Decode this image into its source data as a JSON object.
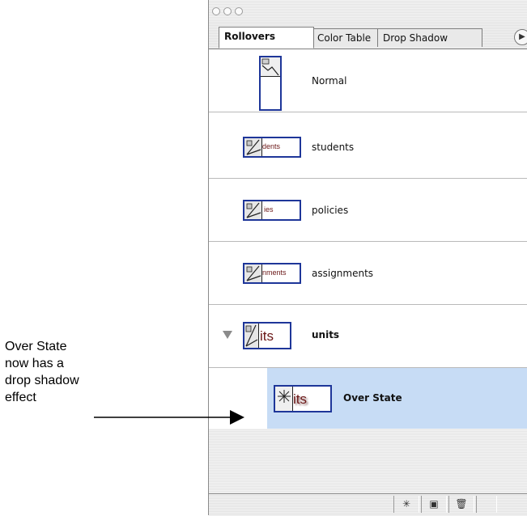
{
  "tabs": [
    {
      "label": "Rollovers",
      "active": true
    },
    {
      "label": "Color Table",
      "active": false
    },
    {
      "label": "Drop Shadow",
      "active": false
    }
  ],
  "menu_icon": "triangle-right-icon",
  "rows": [
    {
      "label": "Normal",
      "thumb_text": ""
    },
    {
      "label": "students",
      "thumb_text": "dents"
    },
    {
      "label": "policies",
      "thumb_text": "ies"
    },
    {
      "label": "assignments",
      "thumb_text": "nments"
    },
    {
      "label": "units",
      "thumb_text": "its",
      "expanded": true
    },
    {
      "label": "Over State",
      "thumb_text": "its",
      "selected": true
    }
  ],
  "bottom_buttons": [
    {
      "icon": "new-rollover-icon",
      "glyph": "✳"
    },
    {
      "icon": "duplicate-icon",
      "glyph": "▣"
    },
    {
      "icon": "trash-icon",
      "glyph": "🗑"
    }
  ],
  "annotation": {
    "lines": [
      "Over State",
      "now has a",
      "drop shadow",
      "effect"
    ]
  },
  "colors": {
    "selection": "#c7dcf5",
    "thumb_border": "#1e3699",
    "thumb_text": "#6a1616"
  }
}
